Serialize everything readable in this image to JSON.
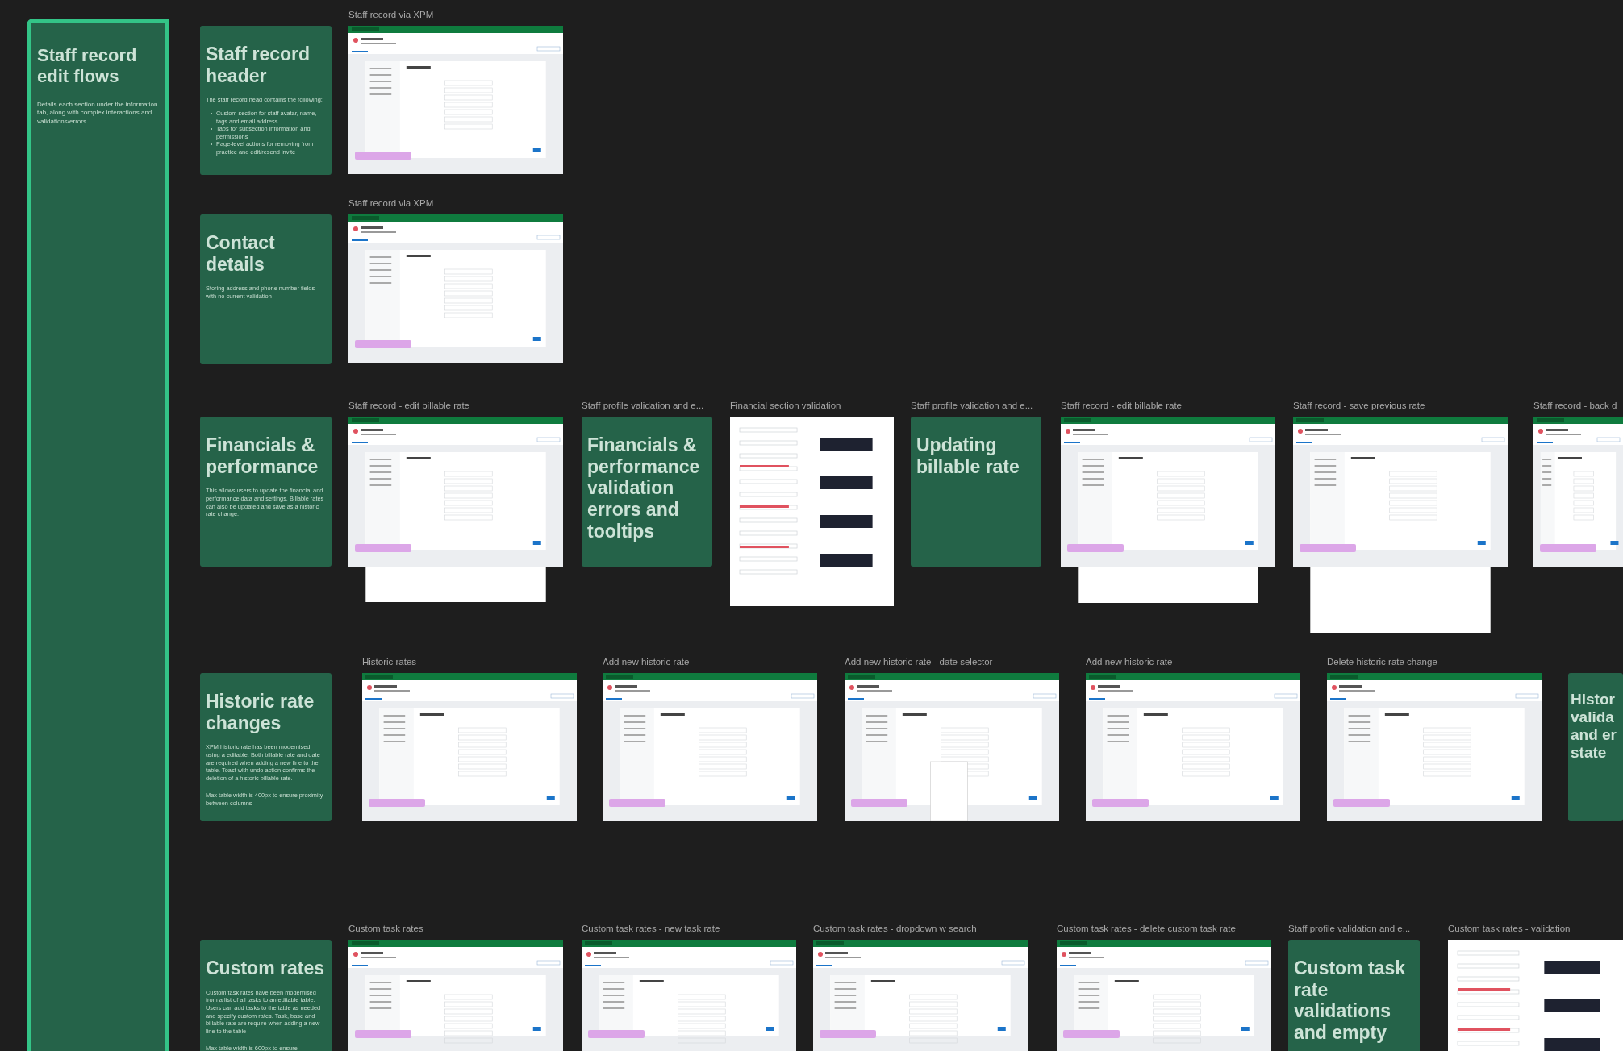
{
  "overview": {
    "title": "Staff record edit flows",
    "description": "Details each section under the information tab, along with complex interactions and validations/errors"
  },
  "sections": [
    {
      "card": {
        "title": "Staff record header",
        "paragraphs": [
          "The staff record head contains the following:"
        ],
        "bullets": [
          "Custom section for staff avatar, name, tags and email address",
          "Tabs for subsection information and permissions",
          "Page-level actions for removing from practice and edit/resend invite"
        ]
      },
      "frames": [
        {
          "kind": "screen",
          "label": "Staff record via XPM"
        }
      ]
    },
    {
      "card": {
        "title": "Contact details",
        "paragraphs": [
          "Storing address and phone number fields with no current validation"
        ]
      },
      "frames": [
        {
          "kind": "screen",
          "label": "Staff record via XPM"
        }
      ]
    },
    {
      "card": {
        "title": "Financials & performance",
        "paragraphs": [
          "This allows users to update the financial and performance data and settings. Billable rates can also be updated and save as a historic rate change."
        ]
      },
      "frames": [
        {
          "kind": "screen",
          "label": "Staff record - edit billable rate"
        },
        {
          "kind": "note",
          "label": "Staff profile validation and e...",
          "title": "Financials & performance validation errors and tooltips"
        },
        {
          "kind": "document",
          "label": "Financial section validation"
        },
        {
          "kind": "note",
          "label": "Staff profile validation and e...",
          "title": "Updating billable rate"
        },
        {
          "kind": "screen",
          "label": "Staff record - edit billable rate"
        },
        {
          "kind": "screen",
          "label": "Staff record - save previous rate"
        },
        {
          "kind": "screen",
          "label": "Staff record - back d"
        }
      ]
    },
    {
      "card": {
        "title": "Historic rate changes",
        "paragraphs": [
          "XPM historic rate has been modernised using a editable. Both billable rate and date are required when adding a new line to the table. Toast with undo action confirms the deletion of a historic billable rate.",
          "Max table width is 400px to ensure proximity between columns"
        ]
      },
      "frames": [
        {
          "kind": "screen",
          "label": "Historic rates"
        },
        {
          "kind": "screen",
          "label": "Add new historic rate"
        },
        {
          "kind": "screen",
          "label": "Add new historic rate - date selector"
        },
        {
          "kind": "screen",
          "label": "Add new historic rate"
        },
        {
          "kind": "screen",
          "label": "Delete historic rate change"
        },
        {
          "kind": "note",
          "title": "Histor\nvalida\nand er\nstate"
        }
      ]
    },
    {
      "card": {
        "title": "Custom rates",
        "paragraphs": [
          "Custom task rates have been modernised from a list of all tasks to an editable table. Users can add tasks to the table as needed and specify custom rates. Task, base and billable rate are require when adding a new line to the table",
          "Max table width is 600px to ensure"
        ]
      },
      "frames": [
        {
          "kind": "screen",
          "label": "Custom task rates"
        },
        {
          "kind": "screen",
          "label": "Custom task rates - new task rate"
        },
        {
          "kind": "screen",
          "label": "Custom task rates - dropdown w search"
        },
        {
          "kind": "screen",
          "label": "Custom task rates - delete custom task rate"
        },
        {
          "kind": "note",
          "label": "Staff profile validation and e...",
          "title": "Custom task rate validations and empty"
        },
        {
          "kind": "document",
          "label": "Custom task rates - validation"
        }
      ]
    }
  ]
}
